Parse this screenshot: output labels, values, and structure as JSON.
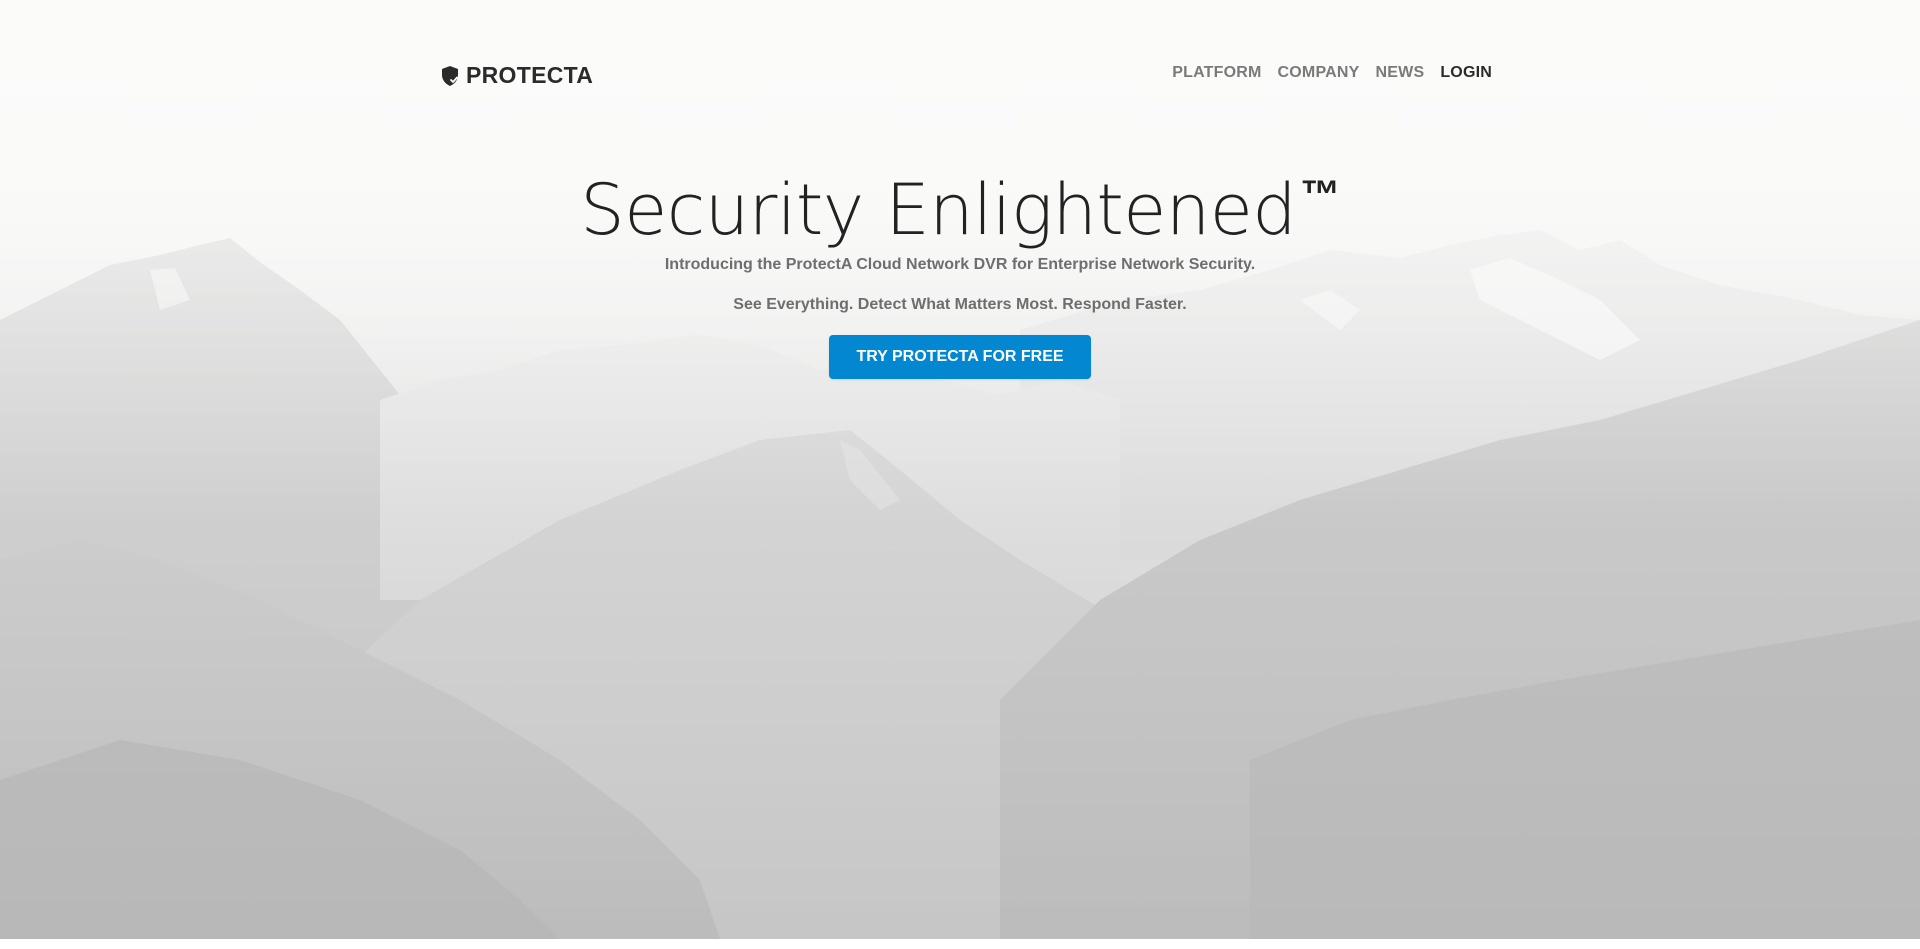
{
  "brand": {
    "name": "PROTECTA",
    "icon": "shield-check-icon"
  },
  "nav": {
    "items": [
      {
        "label": "PLATFORM",
        "active": false
      },
      {
        "label": "COMPANY",
        "active": false
      },
      {
        "label": "NEWS",
        "active": false
      },
      {
        "label": "LOGIN",
        "active": true
      }
    ]
  },
  "hero": {
    "headline": "Security Enlightened",
    "trademark": "™",
    "tagline": "Introducing the ProtectA Cloud Network DVR for Enterprise Network Security.",
    "subtagline": "See Everything. Detect What Matters Most. Respond Faster.",
    "cta_label": "TRY PROTECTA FOR FREE",
    "background": "mountain-landscape"
  },
  "colors": {
    "accent": "#0487d1",
    "text_dark": "#2b2b2b",
    "text_muted": "#7a7a7a"
  }
}
